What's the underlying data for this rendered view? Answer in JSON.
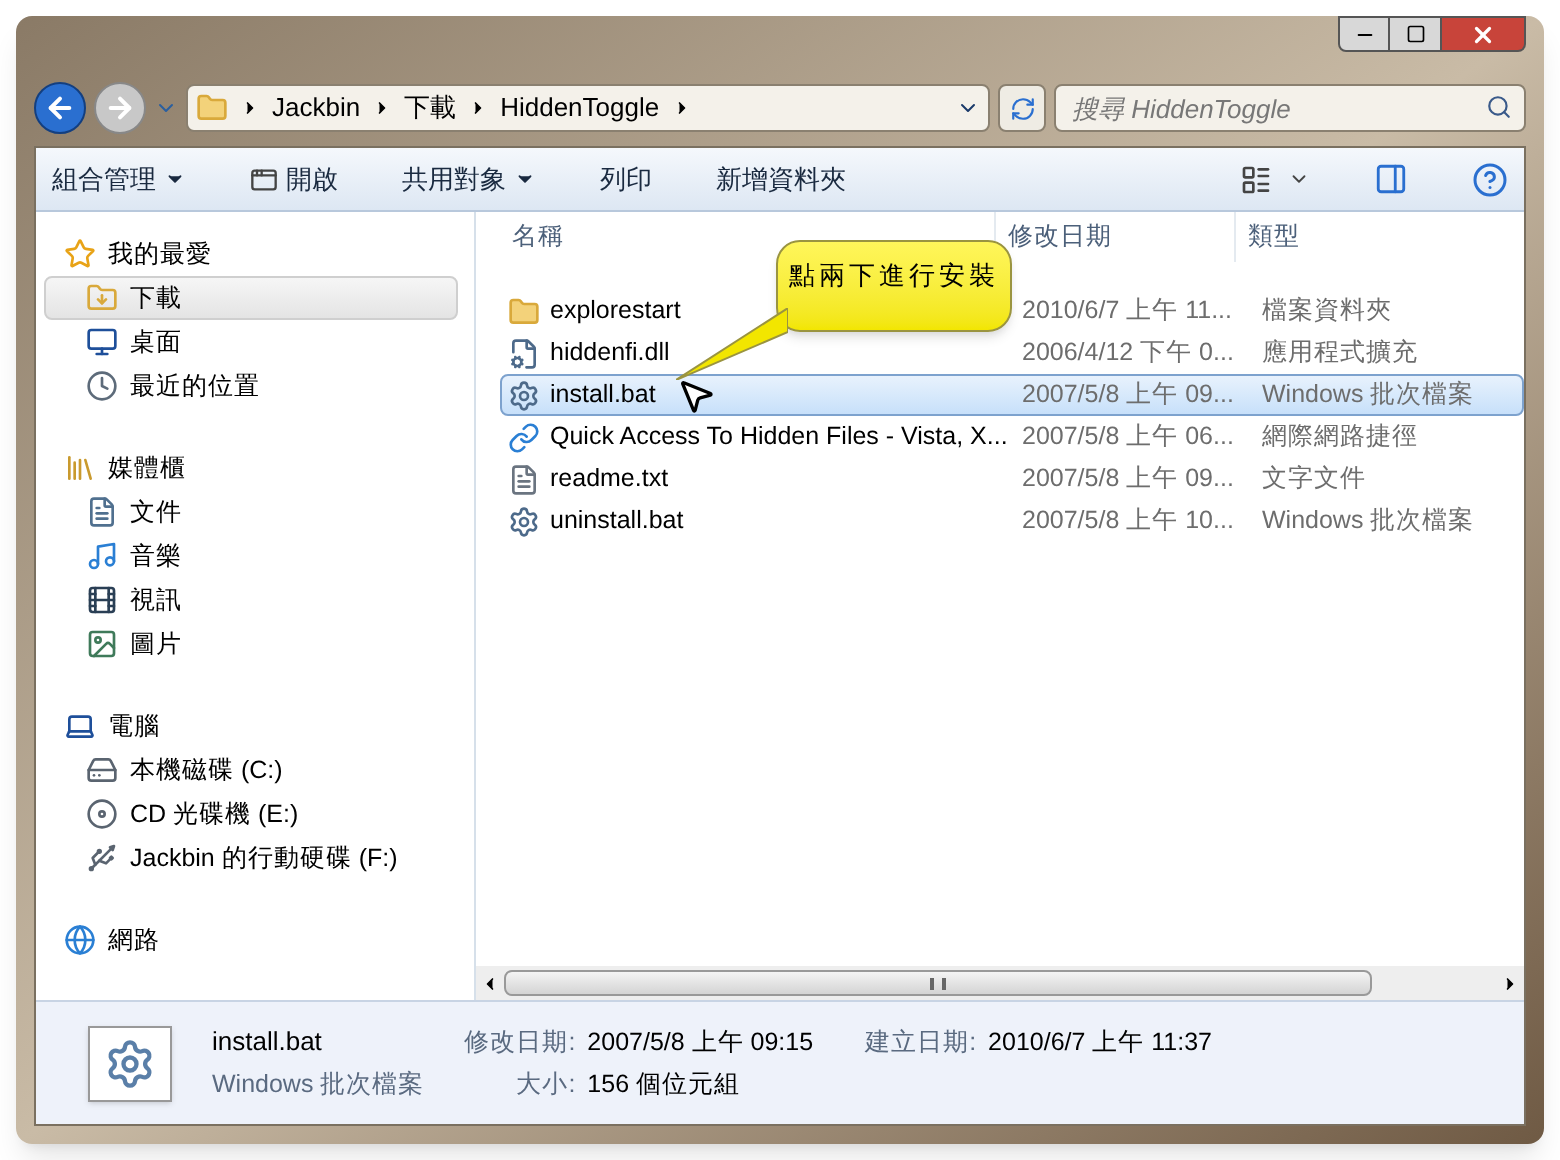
{
  "address_bar": {
    "crumbs": [
      "Jackbin",
      "下載",
      "HiddenToggle"
    ]
  },
  "search": {
    "placeholder": "搜尋 HiddenToggle"
  },
  "toolbar": {
    "items": [
      {
        "label": "組合管理",
        "kind": "menu"
      },
      {
        "label": "開啟",
        "kind": "open"
      },
      {
        "label": "共用對象",
        "kind": "menu"
      },
      {
        "label": "列印",
        "kind": "plain"
      },
      {
        "label": "新增資料夾",
        "kind": "plain"
      }
    ]
  },
  "sidebar": {
    "groups": [
      {
        "label": "我的最愛",
        "kind": "favorites",
        "children": [
          {
            "label": "下載",
            "kind": "downloads",
            "selected": true
          },
          {
            "label": "桌面",
            "kind": "desktop",
            "selected": false
          },
          {
            "label": "最近的位置",
            "kind": "recent",
            "selected": false
          }
        ]
      },
      {
        "label": "媒體櫃",
        "kind": "libraries",
        "children": [
          {
            "label": "文件",
            "kind": "documents",
            "selected": false
          },
          {
            "label": "音樂",
            "kind": "music",
            "selected": false
          },
          {
            "label": "視訊",
            "kind": "video",
            "selected": false
          },
          {
            "label": "圖片",
            "kind": "pictures",
            "selected": false
          }
        ]
      },
      {
        "label": "電腦",
        "kind": "computer",
        "children": [
          {
            "label": "本機磁碟 (C:)",
            "kind": "disk",
            "selected": false
          },
          {
            "label": "CD 光碟機 (E:)",
            "kind": "cd",
            "selected": false
          },
          {
            "label": "Jackbin 的行動硬碟 (F:)",
            "kind": "removable",
            "selected": false
          }
        ]
      },
      {
        "label": "網路",
        "kind": "network"
      }
    ]
  },
  "file_list": {
    "columns": [
      "名稱",
      "修改日期",
      "類型"
    ],
    "rows": [
      {
        "name": "explorestart",
        "modified": "2010/6/7 上午 11...",
        "type": "檔案資料夾",
        "kind": "folder",
        "selected": false
      },
      {
        "name": "hiddenfi.dll",
        "modified": "2006/4/12 下午 0...",
        "type": "應用程式擴充",
        "kind": "dll",
        "selected": false
      },
      {
        "name": "install.bat",
        "modified": "2007/5/8 上午 09...",
        "type": "Windows 批次檔案",
        "kind": "bat",
        "selected": true
      },
      {
        "name": "Quick Access To Hidden Files - Vista, X...",
        "modified": "2007/5/8 上午 06...",
        "type": "網際網路捷徑",
        "kind": "link",
        "selected": false
      },
      {
        "name": "readme.txt",
        "modified": "2007/5/8 上午 09...",
        "type": "文字文件",
        "kind": "txt",
        "selected": false
      },
      {
        "name": "uninstall.bat",
        "modified": "2007/5/8 上午 10...",
        "type": "Windows 批次檔案",
        "kind": "bat",
        "selected": false
      }
    ]
  },
  "callout": {
    "text": "點兩下進行安裝"
  },
  "details": {
    "name": "install.bat",
    "type": "Windows 批次檔案",
    "fields": [
      {
        "label": "修改日期:",
        "value": "2007/5/8 上午 09:15"
      },
      {
        "label": "建立日期:",
        "value": "2010/6/7 上午 11:37"
      },
      {
        "label": "大小:",
        "value": "156 個位元組"
      }
    ]
  }
}
